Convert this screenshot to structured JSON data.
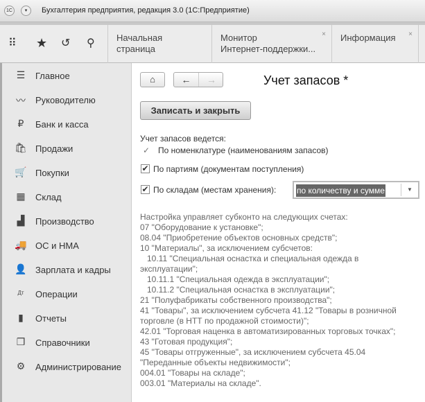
{
  "window": {
    "title": "Бухгалтерия предприятия, редакция 3.0  (1С:Предприятие)",
    "logo": "1С"
  },
  "toolbar": {
    "icons": [
      "apps-grid-icon",
      "star-icon",
      "history-icon",
      "search-icon"
    ]
  },
  "tabs": [
    {
      "label": "Начальная страница",
      "closable": false
    },
    {
      "label": "Монитор\nИнтернет-поддержки...",
      "closable": true
    },
    {
      "label": "Информация",
      "closable": true
    }
  ],
  "sidebar": {
    "items": [
      {
        "label": "Главное",
        "icon": "menu-lines-icon"
      },
      {
        "label": "Руководителю",
        "icon": "trend-icon"
      },
      {
        "label": "Банк и касса",
        "icon": "ruble-icon"
      },
      {
        "label": "Продажи",
        "icon": "shopping-bag-icon"
      },
      {
        "label": "Покупки",
        "icon": "cart-icon"
      },
      {
        "label": "Склад",
        "icon": "warehouse-icon"
      },
      {
        "label": "Производство",
        "icon": "factory-icon"
      },
      {
        "label": "ОС и НМА",
        "icon": "truck-icon"
      },
      {
        "label": "Зарплата и кадры",
        "icon": "person-icon"
      },
      {
        "label": "Операции",
        "icon": "debit-credit-icon"
      },
      {
        "label": "Отчеты",
        "icon": "bar-chart-icon"
      },
      {
        "label": "Справочники",
        "icon": "books-icon"
      },
      {
        "label": "Администрирование",
        "icon": "gear-icon"
      }
    ]
  },
  "form": {
    "title": "Учет запасов *",
    "save_close": "Записать и закрыть",
    "mode_label": "Учет запасов ведется:",
    "by_nomenclature": "По номенклатуре (наименованиям запасов)",
    "by_batches": {
      "label": "По партиям (документам поступления)",
      "checked": true
    },
    "by_warehouses": {
      "label": "По складам (местам хранения):",
      "checked": true
    },
    "warehouse_mode": "по количеству и сумме",
    "note": [
      "Настройка управляет субконто на следующих счетах:",
      "07 \"Оборудование к установке\";",
      "08.04 \"Приобретение объектов основных средств\";",
      "10 \"Материалы\", за исключением субсчетов:",
      "   10.11 \"Специальная оснастка и специальная одежда в",
      "эксплуатации\";",
      "   10.11.1 \"Специальная одежда в эксплуатации\";",
      "   10.11.2 \"Специальная оснастка в эксплуатации\";",
      "21 \"Полуфабрикаты собственного производства\";",
      "41 \"Товары\", за исключением субсчета 41.12 \"Товары в розничной",
      "торговле (в НТТ по продажной стоимости)\";",
      "42.01 \"Торговая наценка в автоматизированных торговых точках\";",
      "43 \"Готовая продукция\";",
      "45 \"Товары отгруженные\", за исключением субсчета 45.04",
      "\"Переданные объекты недвижимости\";",
      "004.01 \"Товары на складе\";",
      "003.01 \"Материалы на складе\"."
    ]
  }
}
